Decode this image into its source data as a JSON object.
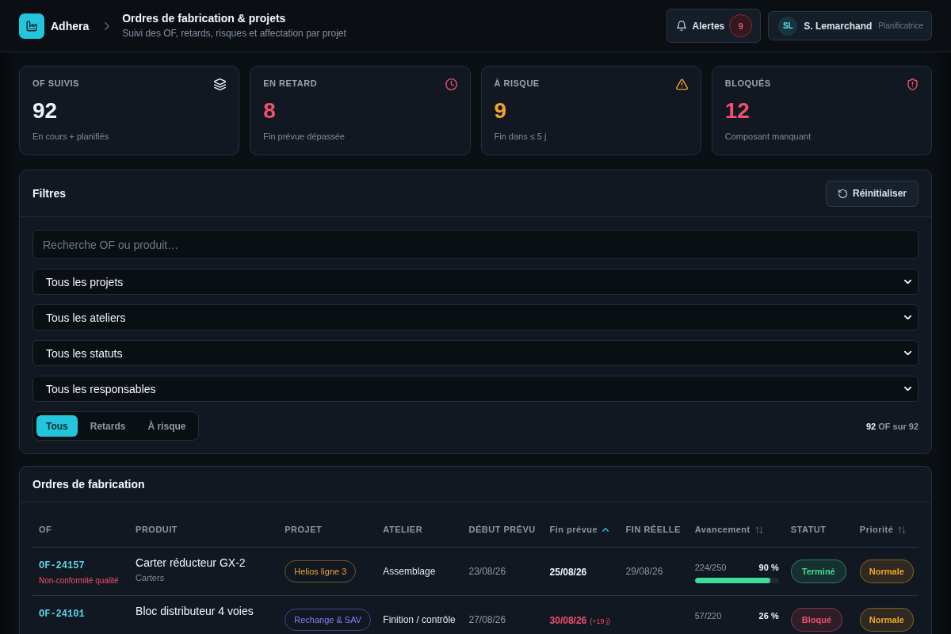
{
  "header": {
    "app_name": "Adhera",
    "title": "Ordres de fabrication & projets",
    "subtitle": "Suivi des OF, retards, risques et affectation par projet",
    "alerts": {
      "label": "Alertes",
      "count": "9"
    },
    "user": {
      "initials": "SL",
      "name": "S. Lemarchand",
      "role": "Planificatrice"
    }
  },
  "kpis": [
    {
      "kind": "layers",
      "label": "OF SUIVIS",
      "value": "92",
      "caption": "En cours + planifiés",
      "color": "#f1f5f9"
    },
    {
      "kind": "clock",
      "label": "EN RETARD",
      "value": "8",
      "caption": "Fin prévue dépassée",
      "color": "#f0506e"
    },
    {
      "kind": "warning",
      "label": "À RISQUE",
      "value": "9",
      "caption": "Fin dans ≤ 5 j",
      "color": "#f5a524"
    },
    {
      "kind": "shield",
      "label": "BLOQUÉS",
      "value": "12",
      "caption": "Composant manquant",
      "color": "#f0506e"
    }
  ],
  "filters": {
    "title": "Filtres",
    "reset": "Réinitialiser",
    "search": {
      "placeholder": "Recherche OF ou produit…"
    },
    "selects": [
      "Tous les projets",
      "Tous les ateliers",
      "Tous les statuts",
      "Tous les responsables"
    ],
    "views": [
      {
        "label": "Tous",
        "selected": true
      },
      {
        "label": "Retards",
        "selected": false
      },
      {
        "label": "À risque",
        "selected": false
      }
    ],
    "count": "**92** OF sur 92"
  },
  "table": {
    "title": "Ordres de fabrication",
    "columns": [
      {
        "label": "OF",
        "sortable": false
      },
      {
        "label": "PRODUIT",
        "sortable": false
      },
      {
        "label": "PROJET",
        "sortable": false
      },
      {
        "label": "ATELIER",
        "sortable": false
      },
      {
        "label": "DÉBUT PRÉVU",
        "sortable": false
      },
      {
        "label": "Fin prévue",
        "sortable": true,
        "sorted": true
      },
      {
        "label": "FIN RÉELLE",
        "sortable": false
      },
      {
        "label": "Avancement",
        "sortable": true,
        "sorted": false
      },
      {
        "label": "STATUT",
        "sortable": false
      },
      {
        "label": "Priorité",
        "sortable": true,
        "sorted": false
      }
    ],
    "rows": [
      {
        "of": "OF-24157",
        "note": "Non-conformité qualité",
        "product": "Carter réducteur GX-2",
        "category": "Carters",
        "project": {
          "label": "Helios ligne 3",
          "color": "#e8a23a"
        },
        "workshop": "Assemblage",
        "start": "23/08/26",
        "end": "25/08/26",
        "late": false,
        "actual_end": "29/08/26",
        "progress": {
          "count": "224/250",
          "percent": "90 %",
          "level": 0.9
        },
        "status": {
          "label": "Terminé",
          "color": "#3ddc97"
        },
        "priority": {
          "label": "Normale",
          "color": "#f5a524"
        }
      },
      {
        "of": "OF-24101",
        "product": "Bloc distributeur 4 voies",
        "project": {
          "label": "Rechange & SAV",
          "color": "#8b7cf6"
        },
        "workshop": "Finition / contrôle",
        "start": "27/08/26",
        "end": "30/08/26",
        "late": true,
        "delay": "(+19 j)",
        "progress": {
          "count": "57/220",
          "percent": "26 %"
        },
        "status": {
          "label": "Bloqué",
          "color": "#f0506e"
        },
        "priority": {
          "label": "Normale",
          "color": "#f5a524"
        }
      }
    ]
  }
}
